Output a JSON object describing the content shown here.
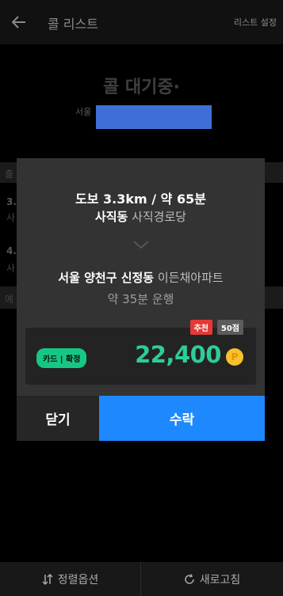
{
  "header": {
    "title": "콜 리스트",
    "settings_label": "리스트 설정"
  },
  "background": {
    "status": "콜 대기중·",
    "location_label": "서울",
    "section_1": "출",
    "item_1_num": "3.",
    "item_1_sub": "사",
    "item_2_num": "4.",
    "item_2_sub": "사",
    "section_2": "예"
  },
  "modal": {
    "walk_info": "도보 3.3km / 약 65분",
    "origin_area": "사직동",
    "origin_place": "사직경로당",
    "dest_area": "서울 양천구 신정동",
    "dest_place": "이든채아파트",
    "duration": "약 35분 운행",
    "badge_recommend": "추천",
    "badge_score": "50점",
    "payment": "카드 | 확정",
    "fare": "22,400",
    "coin_symbol": "P",
    "close_label": "닫기",
    "accept_label": "수락"
  },
  "bottom": {
    "sort_label": "정렬옵션",
    "refresh_label": "새로고침"
  },
  "colors": {
    "accept": "#1e88ff",
    "fare": "#2ecc9a",
    "payment_chip": "#16c784",
    "recommend": "#e53935"
  }
}
